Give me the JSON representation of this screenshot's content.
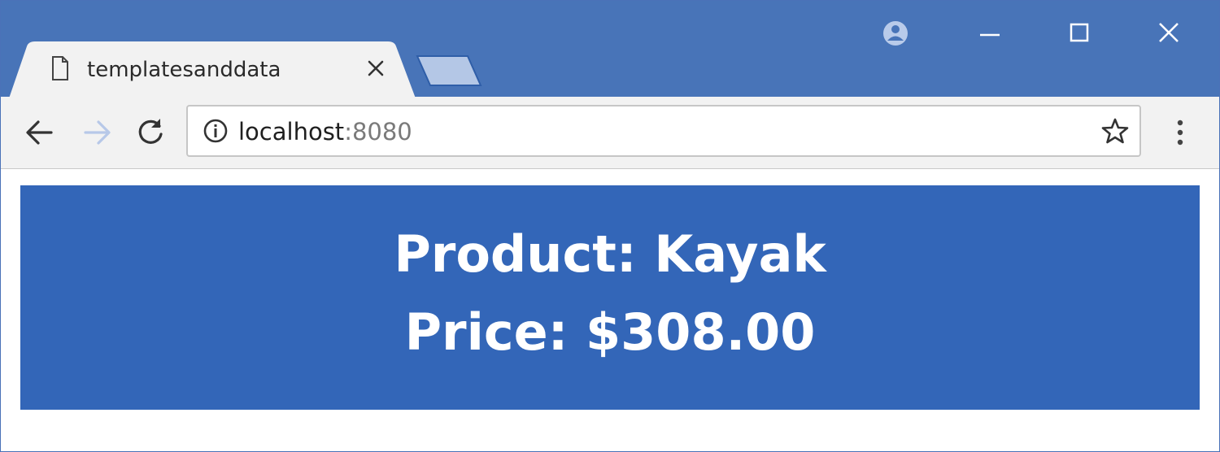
{
  "browser": {
    "tab": {
      "title": "templatesanddata",
      "icon": "page-icon"
    },
    "window_controls": [
      "profile-icon",
      "minimize-icon",
      "maximize-icon",
      "close-icon"
    ],
    "toolbar": {
      "url_host": "localhost",
      "url_port": ":8080"
    },
    "colors": {
      "titlebar": "#4874b8",
      "panel": "#3366b8",
      "panel_text": "#ffffff"
    }
  },
  "page": {
    "product_line": "Product: Kayak",
    "price_line": "Price: $308.00"
  }
}
